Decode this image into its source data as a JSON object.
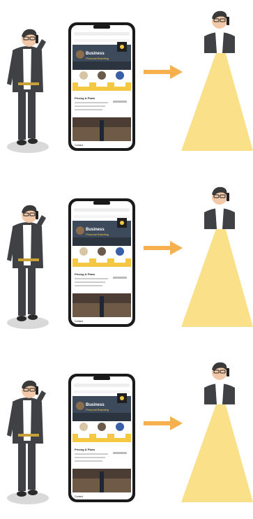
{
  "rows": [
    {
      "phone": {
        "screen_title_line1": "Business",
        "screen_title_line2": "Personal Branding",
        "section_heading": "Pricing & Plans",
        "bottom_label": "Contact"
      }
    },
    {
      "phone": {
        "screen_title_line1": "Business",
        "screen_title_line2": "Personal Branding",
        "section_heading": "Pricing & Plans",
        "bottom_label": "Contact"
      }
    },
    {
      "phone": {
        "screen_title_line1": "Business",
        "screen_title_line2": "Personal Branding",
        "section_heading": "Pricing & Plans",
        "bottom_label": "Contact"
      }
    }
  ],
  "colors": {
    "accent_yellow": "#f5c842",
    "beam_yellow": "#fbe08a",
    "arrow_orange": "#f6b04d",
    "suit_gray": "#3f4144",
    "shadow_gray": "#d9d9d9",
    "phone_black": "#1a1a1a"
  }
}
